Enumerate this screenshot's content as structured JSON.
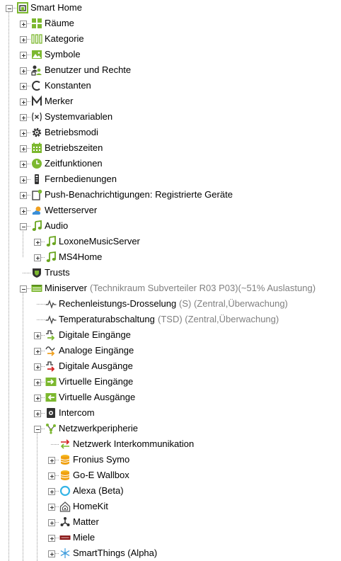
{
  "root": {
    "label": "Smart Home",
    "icon": "home-icon"
  },
  "level1": [
    {
      "label": "Räume",
      "icon": "rooms-grid-icon"
    },
    {
      "label": "Kategorie",
      "icon": "category-bars-icon"
    },
    {
      "label": "Symbole",
      "icon": "image-symbol-icon"
    },
    {
      "label": "Benutzer und Rechte",
      "icon": "users-icon"
    },
    {
      "label": "Konstanten",
      "icon": "constant-c-icon"
    },
    {
      "label": "Merker",
      "icon": "marker-m-icon"
    },
    {
      "label": "Systemvariablen",
      "icon": "variable-x-icon"
    },
    {
      "label": "Betriebsmodi",
      "icon": "gear-icon"
    },
    {
      "label": "Betriebszeiten",
      "icon": "calendar-icon"
    },
    {
      "label": "Zeitfunktionen",
      "icon": "clock-icon"
    },
    {
      "label": "Fernbedienungen",
      "icon": "remote-control-icon"
    },
    {
      "label": "Push-Benachrichtigungen: Registrierte Geräte",
      "icon": "push-notification-icon"
    },
    {
      "label": "Wetterserver",
      "icon": "weather-icon"
    },
    {
      "label": "Audio",
      "icon": "music-note-icon"
    }
  ],
  "audio_children": [
    {
      "label": "LoxoneMusicServer",
      "icon": "music-note-icon"
    },
    {
      "label": "MS4Home",
      "icon": "music-note-icon"
    }
  ],
  "trusts": {
    "label": "Trusts",
    "icon": "shield-icon"
  },
  "miniserver": {
    "label": "Miniserver",
    "detail": "(Technikraum Subverteiler R03 P03)(~51% Auslastung)",
    "icon": "miniserver-icon"
  },
  "mini_children": [
    {
      "label": "Rechenleistungs-Drosselung",
      "detail": "(S) (Zentral,Überwachung)",
      "icon": "pulse-icon"
    },
    {
      "label": "Temperaturabschaltung",
      "detail": "(TSD) (Zentral,Überwachung)",
      "icon": "pulse-icon"
    },
    {
      "label": "Digitale Eingänge",
      "icon": "digital-input-icon"
    },
    {
      "label": "Analoge Eingänge",
      "icon": "analog-input-icon"
    },
    {
      "label": "Digitale Ausgänge",
      "icon": "digital-output-icon"
    },
    {
      "label": "Virtuelle Eingänge",
      "icon": "virtual-input-icon"
    },
    {
      "label": "Virtuelle Ausgänge",
      "icon": "virtual-output-icon"
    },
    {
      "label": "Intercom",
      "icon": "intercom-icon"
    },
    {
      "label": "Netzwerkperipherie",
      "icon": "network-icon"
    }
  ],
  "network_children": [
    {
      "label": "Netzwerk Interkommunikation",
      "icon": "intercommunication-icon"
    },
    {
      "label": "Fronius Symo",
      "icon": "database-icon"
    },
    {
      "label": "Go-E Wallbox",
      "icon": "database-icon"
    },
    {
      "label": "Alexa (Beta)",
      "icon": "alexa-icon"
    },
    {
      "label": "HomeKit",
      "icon": "homekit-icon"
    },
    {
      "label": "Matter",
      "icon": "matter-icon"
    },
    {
      "label": "Miele",
      "icon": "miele-icon"
    },
    {
      "label": "SmartThings (Alpha)",
      "icon": "smartthings-icon"
    }
  ],
  "colors": {
    "green": "#7cb82f",
    "tree_line": "#9a9a9a",
    "secondary_text": "#808080",
    "audio_green": "#6aa51f",
    "orange": "#f0a020",
    "red": "#d32020",
    "alexa_blue": "#34b4e6"
  }
}
